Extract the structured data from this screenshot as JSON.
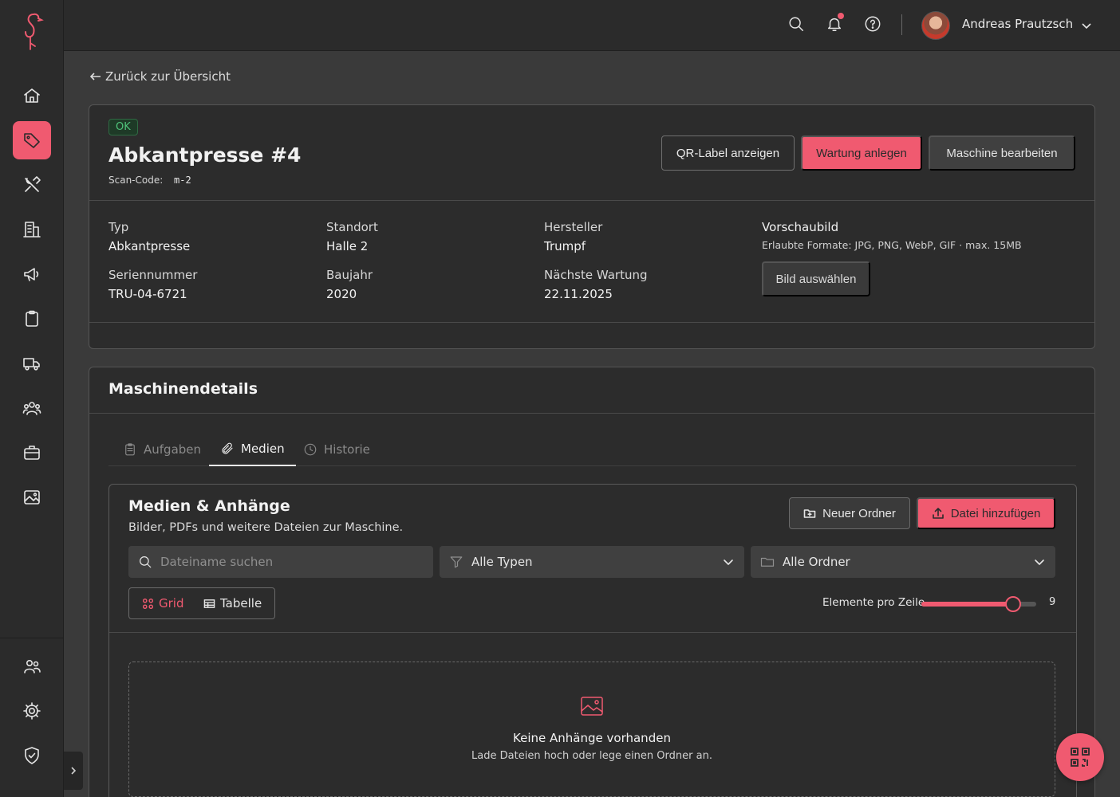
{
  "topbar": {
    "user_name": "Andreas Prautzsch"
  },
  "back_link": "Zurück zur Übersicht",
  "machine": {
    "status": "OK",
    "title": "Abkantpresse #4",
    "scan_label": "Scan-Code:",
    "scan_code": "m-2",
    "actions": {
      "qr": "QR-Label anzeigen",
      "maintenance": "Wartung anlegen",
      "edit": "Maschine bearbeiten"
    },
    "fields": [
      {
        "label": "Typ",
        "value": "Abkantpresse"
      },
      {
        "label": "Standort",
        "value": "Halle 2"
      },
      {
        "label": "Hersteller",
        "value": "Trumpf"
      },
      {
        "label": "Seriennummer",
        "value": "TRU-04-6721"
      },
      {
        "label": "Baujahr",
        "value": "2020"
      },
      {
        "label": "Nächste Wartung",
        "value": "22.11.2025"
      }
    ],
    "preview": {
      "title": "Vorschaubild",
      "hint": "Erlaubte Formate: JPG, PNG, WebP, GIF · max. 15MB",
      "button": "Bild auswählen"
    }
  },
  "details": {
    "title": "Maschinendetails",
    "tabs": [
      {
        "label": "Aufgaben",
        "icon": "clipboard-icon",
        "active": false
      },
      {
        "label": "Medien",
        "icon": "paperclip-icon",
        "active": true
      },
      {
        "label": "Historie",
        "icon": "clock-icon",
        "active": false
      }
    ]
  },
  "media": {
    "title": "Medien & Anhänge",
    "subtitle": "Bilder, PDFs und weitere Dateien zur Maschine.",
    "new_folder": "Neuer Ordner",
    "add_file": "Datei hinzufügen",
    "search_placeholder": "Dateiname suchen",
    "type_filter": "Alle Typen",
    "folder_filter": "Alle Ordner",
    "view_grid": "Grid",
    "view_table": "Tabelle",
    "per_row_label": "Elemente pro Zeile",
    "per_row_value": "9",
    "per_row_fraction": 0.8,
    "empty_title": "Keine Anhänge vorhanden",
    "empty_sub": "Lade Dateien hoch oder lege einen Ordner an."
  },
  "colors": {
    "accent": "#f05a70",
    "status_ok": "#4fc27a"
  }
}
